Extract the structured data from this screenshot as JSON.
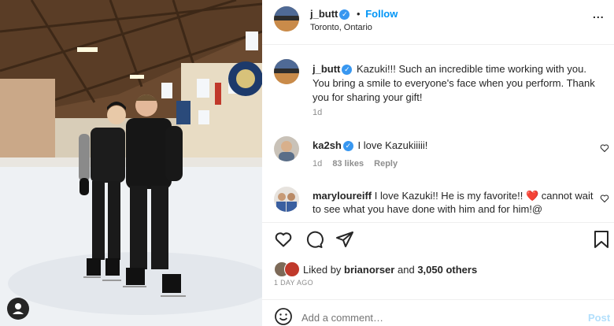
{
  "header": {
    "username": "j_butt",
    "dot": "•",
    "follow_label": "Follow",
    "location": "Toronto, Ontario",
    "more": "..."
  },
  "caption": {
    "username": "j_butt",
    "text": "Kazuki!!! Such an incredible time working with you. You bring a smile to everyone's face when you perform. Thank you for sharing your gift!",
    "time": "1d"
  },
  "comments": [
    {
      "username": "ka2sh",
      "text": "I love Kazukiiiii!",
      "time": "1d",
      "likes": "83 likes",
      "reply": "Reply"
    },
    {
      "username": "maryloureiff",
      "text": "I love Kazuki!! He is my favorite!! ❤️ cannot wait to see what you have done with him and for him!@"
    }
  ],
  "likes": {
    "prefix": "Liked by",
    "user": "brianorser",
    "and": "and",
    "others": "3,050 others"
  },
  "date": "1 DAY AGO",
  "comment_box": {
    "placeholder": "Add a comment…",
    "post_label": "Post"
  },
  "colors": {
    "link": "#0095f6",
    "verified": "#3897f0",
    "heart": "#ed4956"
  },
  "icons": [
    "heart-icon",
    "comment-icon",
    "share-icon",
    "bookmark-icon",
    "emoji-icon",
    "user-tag-icon",
    "more-icon",
    "verified-icon"
  ]
}
